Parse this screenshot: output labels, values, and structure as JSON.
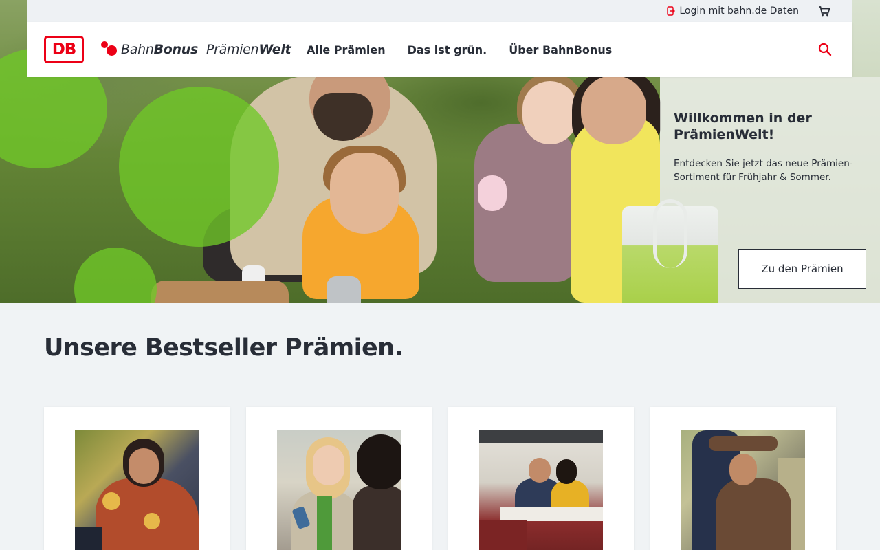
{
  "utility": {
    "login_label": "Login mit bahn.de Daten",
    "login_icon": "login-icon",
    "cart_icon": "cart-icon"
  },
  "nav": {
    "db_logo_text": "DB",
    "brand": {
      "bahn": "Bahn",
      "bonus": "Bonus",
      "praemien": "Prämien",
      "welt": "Welt"
    },
    "links": [
      {
        "label": "Alle Prämien"
      },
      {
        "label": "Das ist grün."
      },
      {
        "label": "Über BahnBonus"
      }
    ],
    "search_icon": "search-icon"
  },
  "hero": {
    "title": "Willkommen in der PrämienWelt!",
    "text": "Entdecken Sie jetzt das neue Prämien-Sortiment für Frühjahr & Sommer.",
    "cta_label": "Zu den Prämien"
  },
  "bestseller": {
    "title": "Unsere Bestseller Prämien.",
    "cards": [
      {
        "image": "woman-in-train-photo"
      },
      {
        "image": "two-women-with-phone-photo"
      },
      {
        "image": "couple-in-dining-car-photo"
      },
      {
        "image": "man-relaxing-in-train-photo"
      }
    ]
  },
  "colors": {
    "brand_red": "#ec0016",
    "text_dark": "#282d37",
    "page_bg": "#f0f3f5",
    "accent_green": "#70c828"
  }
}
